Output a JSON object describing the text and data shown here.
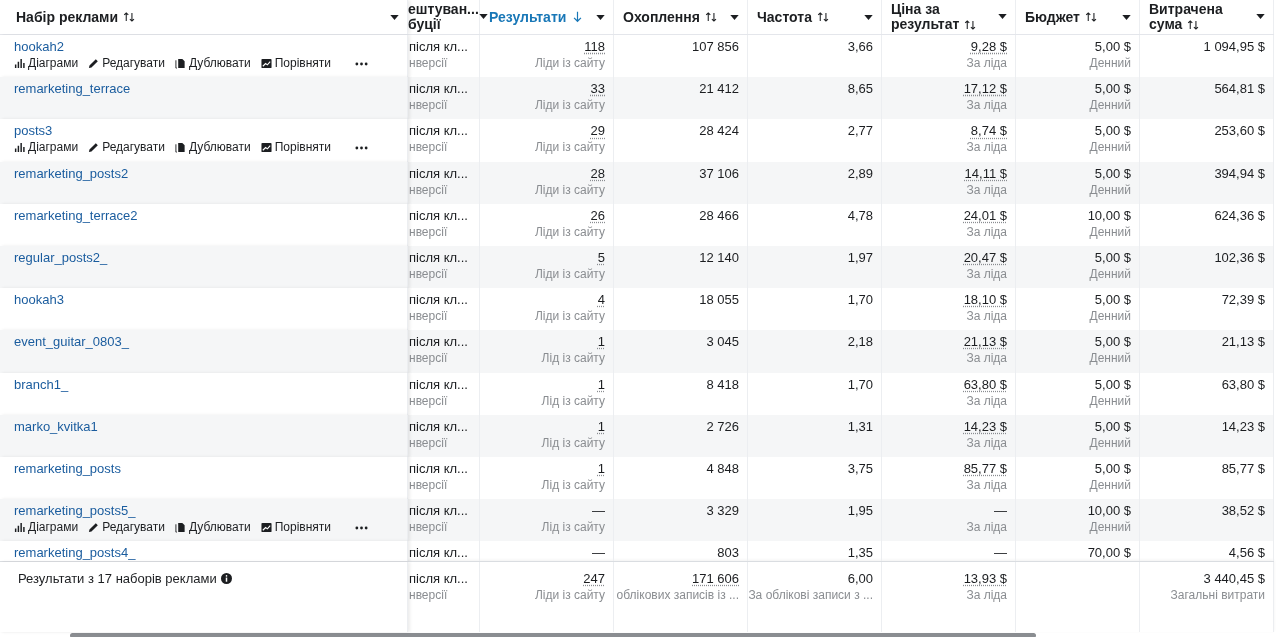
{
  "columns": [
    {
      "lines": [
        "Набір реклами"
      ],
      "kind": "sort",
      "sorted": false
    },
    {
      "lines": [
        "ештуван...",
        "буції"
      ],
      "kind": "plain"
    },
    {
      "lines": [
        "Результати"
      ],
      "kind": "sort",
      "sorted": true
    },
    {
      "lines": [
        "Охоплення"
      ],
      "kind": "sort",
      "sorted": false
    },
    {
      "lines": [
        "Частота"
      ],
      "kind": "sort",
      "sorted": false
    },
    {
      "lines": [
        "Ціна за",
        "результат"
      ],
      "kind": "sort",
      "sorted": false
    },
    {
      "lines": [
        "Бюджет"
      ],
      "kind": "sort",
      "sorted": false
    },
    {
      "lines": [
        "Витрачена",
        "сума"
      ],
      "kind": "sort",
      "sorted": false
    }
  ],
  "rows": [
    {
      "name": "hookah2",
      "actions": [
        "Діаграми",
        "Редагувати",
        "Дублювати",
        "Порівняти"
      ],
      "attribution": "після кл...",
      "attribution_sub": "нверсії",
      "results": "118",
      "results_label": "Ліди із сайту",
      "reach": "107 856",
      "frequency": "3,66",
      "cost": "9,28 $",
      "cost_label": "За ліда",
      "budget": "5,00 $",
      "budget_label": "Денний",
      "spent": "1 094,95 $"
    },
    {
      "name": "remarketing_terrace",
      "attribution": "після кл...",
      "attribution_sub": "нверсії",
      "results": "33",
      "results_label": "Ліди із сайту",
      "reach": "21 412",
      "frequency": "8,65",
      "cost": "17,12 $",
      "cost_label": "За ліда",
      "budget": "5,00 $",
      "budget_label": "Денний",
      "spent": "564,81 $"
    },
    {
      "name": "posts3",
      "actions": [
        "Діаграми",
        "Редагувати",
        "Дублювати",
        "Порівняти"
      ],
      "attribution": "після кл...",
      "attribution_sub": "нверсії",
      "results": "29",
      "results_label": "Ліди із сайту",
      "reach": "28 424",
      "frequency": "2,77",
      "cost": "8,74 $",
      "cost_label": "За ліда",
      "budget": "5,00 $",
      "budget_label": "Денний",
      "spent": "253,60 $"
    },
    {
      "name": "remarketing_posts2",
      "attribution": "після кл...",
      "attribution_sub": "нверсії",
      "results": "28",
      "results_label": "Ліди із сайту",
      "reach": "37 106",
      "frequency": "2,89",
      "cost": "14,11 $",
      "cost_label": "За ліда",
      "budget": "5,00 $",
      "budget_label": "Денний",
      "spent": "394,94 $"
    },
    {
      "name": "remarketing_terrace2",
      "attribution": "після кл...",
      "attribution_sub": "нверсії",
      "results": "26",
      "results_label": "Ліди із сайту",
      "reach": "28 466",
      "frequency": "4,78",
      "cost": "24,01 $",
      "cost_label": "За ліда",
      "budget": "10,00 $",
      "budget_label": "Денний",
      "spent": "624,36 $"
    },
    {
      "name": "regular_posts2_",
      "attribution": "після кл...",
      "attribution_sub": "нверсії",
      "results": "5",
      "results_label": "Ліди із сайту",
      "reach": "12 140",
      "frequency": "1,97",
      "cost": "20,47 $",
      "cost_label": "За ліда",
      "budget": "5,00 $",
      "budget_label": "Денний",
      "spent": "102,36 $"
    },
    {
      "name": "hookah3",
      "attribution": "після кл...",
      "attribution_sub": "нверсії",
      "results": "4",
      "results_label": "Ліди із сайту",
      "reach": "18 055",
      "frequency": "1,70",
      "cost": "18,10 $",
      "cost_label": "За ліда",
      "budget": "5,00 $",
      "budget_label": "Денний",
      "spent": "72,39 $"
    },
    {
      "name": "event_guitar_0803_",
      "attribution": "після кл...",
      "attribution_sub": "нверсії",
      "results": "1",
      "results_label": "Лід із сайту",
      "reach": "3 045",
      "frequency": "2,18",
      "cost": "21,13 $",
      "cost_label": "За ліда",
      "budget": "5,00 $",
      "budget_label": "Денний",
      "spent": "21,13 $"
    },
    {
      "name": "branch1_",
      "attribution": "після кл...",
      "attribution_sub": "нверсії",
      "results": "1",
      "results_label": "Лід із сайту",
      "reach": "8 418",
      "frequency": "1,70",
      "cost": "63,80 $",
      "cost_label": "За ліда",
      "budget": "5,00 $",
      "budget_label": "Денний",
      "spent": "63,80 $"
    },
    {
      "name": "marko_kvitka1",
      "attribution": "після кл...",
      "attribution_sub": "нверсії",
      "results": "1",
      "results_label": "Лід із сайту",
      "reach": "2 726",
      "frequency": "1,31",
      "cost": "14,23 $",
      "cost_label": "За ліда",
      "budget": "5,00 $",
      "budget_label": "Денний",
      "spent": "14,23 $"
    },
    {
      "name": "remarketing_posts",
      "attribution": "після кл...",
      "attribution_sub": "нверсії",
      "results": "1",
      "results_label": "Лід із сайту",
      "reach": "4 848",
      "frequency": "3,75",
      "cost": "85,77 $",
      "cost_label": "За ліда",
      "budget": "5,00 $",
      "budget_label": "Денний",
      "spent": "85,77 $"
    },
    {
      "name": "remarketing_posts5_",
      "actions": [
        "Діаграми",
        "Редагувати",
        "Дублювати",
        "Порівняти"
      ],
      "attribution": "після кл...",
      "attribution_sub": "нверсії",
      "results": "—",
      "results_label": "Лід із сайту",
      "reach": "3 329",
      "frequency": "1,95",
      "cost": "—",
      "cost_label": "За ліда",
      "budget": "10,00 $",
      "budget_label": "Денний",
      "spent": "38,52 $"
    },
    {
      "name": "remarketing_posts4_",
      "attribution": "після кл...",
      "results": "—",
      "reach": "803",
      "frequency": "1,35",
      "cost": "—",
      "budget": "70,00 $",
      "spent": "4,56 $"
    }
  ],
  "summary": {
    "label": "Результати з 17 наборів реклами",
    "attribution": "після кл...",
    "attribution_sub": "нверсії",
    "results": "247",
    "results_label": "Ліди із сайту",
    "reach": "171 606",
    "reach_label": "облікових записів із ...",
    "frequency": "6,00",
    "frequency_label": "За облікові записи з ...",
    "cost": "13,93 $",
    "cost_label": "За ліда",
    "spent": "3 440,45 $",
    "spent_label": "Загальні витрати"
  }
}
